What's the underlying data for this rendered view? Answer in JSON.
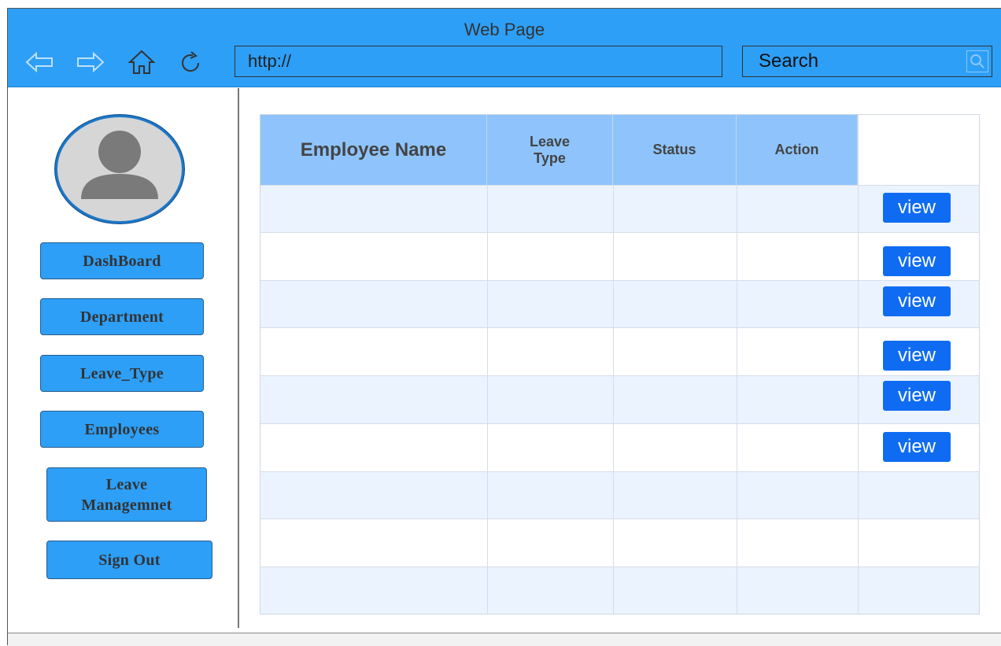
{
  "window": {
    "title": "Web Page"
  },
  "toolbar": {
    "url": "http://",
    "search_label": "Search",
    "icons": [
      "back-arrow-icon",
      "forward-arrow-icon",
      "home-icon",
      "refresh-icon",
      "search-icon"
    ]
  },
  "sidebar": {
    "avatar_icon": "user-avatar-icon",
    "items": [
      {
        "label": "DashBoard"
      },
      {
        "label": "Department"
      },
      {
        "label": "Leave_Type"
      },
      {
        "label": "Employees"
      },
      {
        "label": "Leave Managemnet"
      },
      {
        "label": "Sign Out"
      }
    ]
  },
  "table": {
    "columns": [
      "Employee Name",
      "Leave Type",
      "Status",
      "Action"
    ],
    "view_label": "view",
    "rows": [
      {
        "view": true
      },
      {
        "view": true
      },
      {
        "view": true
      },
      {
        "view": true
      },
      {
        "view": true
      },
      {
        "view": true
      },
      {
        "view": false
      },
      {
        "view": false
      },
      {
        "view": false
      }
    ]
  },
  "colors": {
    "titlebar": "#2d9ff7",
    "header": "#8ec4fb",
    "row_alt": "#eaf3ff",
    "view_button": "#0f6cf2"
  }
}
